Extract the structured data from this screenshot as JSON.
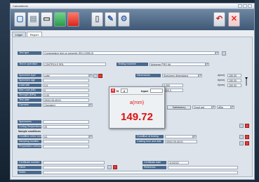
{
  "window": {
    "title": "Calculations"
  },
  "toolbar": {
    "icons": [
      "new-doc-icon",
      "save-icon",
      "print-icon",
      "export-excel-icon",
      "export-pdf-icon",
      "door-exit-icon",
      "tools-icon",
      "settings-icon",
      "undo-icon",
      "close-icon"
    ]
  },
  "tabs": [
    {
      "label": "Lögin"
    },
    {
      "label": "Report"
    }
  ],
  "form": {
    "test_type": {
      "label": "Test type",
      "value": "Compressive test on concrete (EN 12390-3)"
    },
    "test_operation": {
      "label": "Test in operation",
      "value": "CONTROLS SRL"
    },
    "testing_machine": {
      "label": "Testing machine",
      "value": "Automax PRO 6d"
    },
    "specimen_type": {
      "label": "Specimen type",
      "value": "cube"
    },
    "specimen_age": {
      "label": "Specimen age",
      "value": ""
    },
    "load_rate": {
      "label": "Load rate",
      "value": "0,6"
    },
    "max_load": {
      "label": "Max Load (kN)",
      "value": "0"
    },
    "strength": {
      "label": "Strength (MPa)",
      "value": "0,00"
    },
    "test_date": {
      "label": "Test date",
      "value": "09/04 09:45:01"
    },
    "operator": {
      "label": "Operator",
      "value": "Operator1"
    },
    "dimensions": {
      "label": "Dimensions",
      "value": "Specimen dimensions"
    },
    "dim_a": {
      "label": "a(mm)",
      "value": "150,00"
    },
    "dim_b": {
      "label": "b(mm)",
      "value": "150,00"
    },
    "dim_h": {
      "label": "h(mm)",
      "value": "150,00"
    },
    "mass_field": "0,000",
    "density_field": "0000,0",
    "satisfactory": {
      "label": "Satisfactory",
      "value": "Good pat"
    },
    "failure_mode": {
      "value": "ABa"
    },
    "specimens": {
      "label": "Specimens",
      "value": ""
    },
    "curing_temp": {
      "label": "Curing Temperature",
      "value": "20"
    },
    "sample_conditions": "Sample conditions",
    "condition_receipt": {
      "label": "Condition when received",
      "value": "A1"
    },
    "sampling_location": {
      "label": "Sampling location",
      "value": ""
    },
    "preparation_method": {
      "label": "Preparation method",
      "value": ""
    },
    "condition_testing": {
      "label": "Condition at testing",
      "value": ""
    },
    "casting_time": {
      "label": "Casting time and date",
      "value": "09/04 09:45:01"
    },
    "certificate_number": {
      "label": "Certificate number",
      "value": ""
    },
    "certificate_date": {
      "label": "Certificate date",
      "value": "11/02/22"
    },
    "client": {
      "label": "Client",
      "value": ""
    },
    "reference": {
      "label": "Reference",
      "value": ""
    },
    "notes": {
      "label": "Notes",
      "value": ""
    }
  },
  "dialog": {
    "n_label": "N",
    "n_value": "2",
    "input_label": "Input",
    "unit_label": "a(mm)",
    "reading": "149.72"
  }
}
